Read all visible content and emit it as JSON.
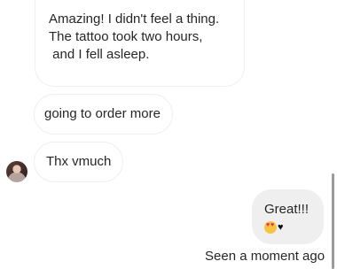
{
  "conversation": {
    "messages": [
      {
        "direction": "incoming",
        "lines": [
          "Amazing! I didn't feel a thing.",
          "The tattoo took two hours,",
          " and I fell asleep."
        ]
      },
      {
        "direction": "incoming",
        "text": "going to order more"
      },
      {
        "direction": "incoming",
        "text": "Thx vmuch"
      },
      {
        "direction": "outgoing",
        "text": "Great!!!",
        "emojis": [
          "heart-eyes-emoji",
          "black-heart-emoji"
        ],
        "black_heart_glyph": "♥"
      }
    ],
    "seen_status": "Seen a moment ago"
  },
  "colors": {
    "incoming_bubble_border": "#efefef",
    "outgoing_bubble_bg": "#efefef",
    "text": "#262626"
  }
}
